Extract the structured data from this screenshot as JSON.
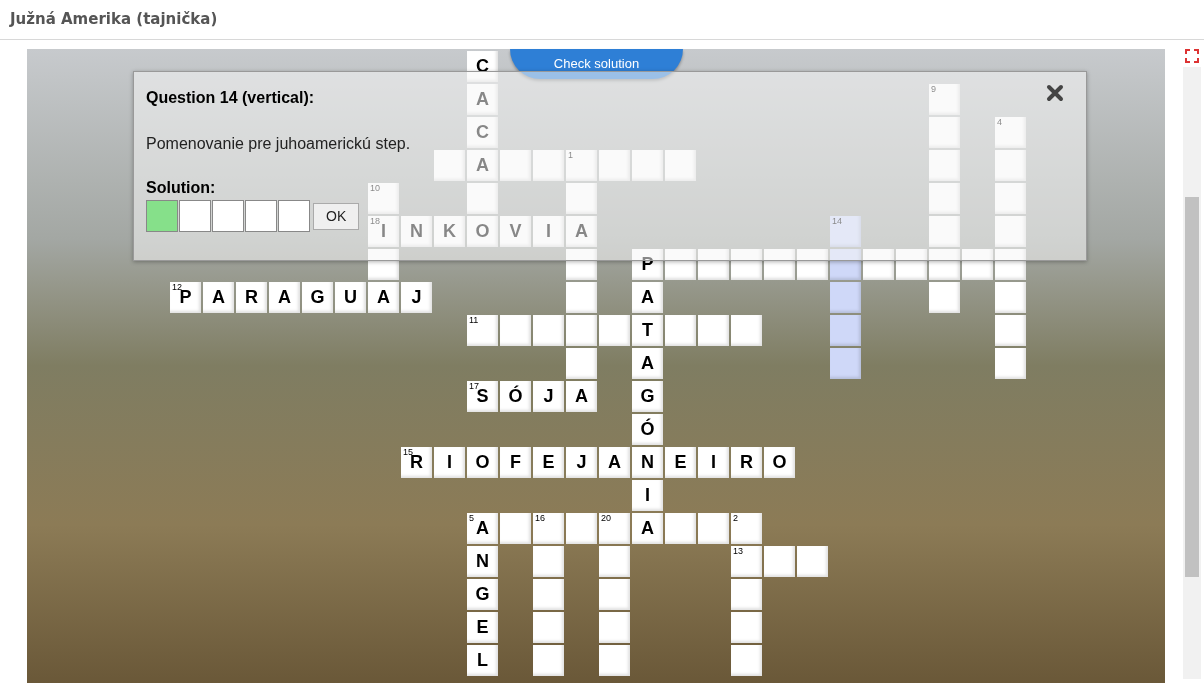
{
  "page_title": "Južná Amerika (tajnička)",
  "check_button": "Check solution",
  "grid": {
    "rows": [
      {
        "cells": [
          null,
          null,
          null,
          null,
          null,
          null,
          null,
          null,
          null,
          {
            "letter": "C",
            "highlighted": false
          },
          null,
          null,
          null,
          null,
          null,
          null,
          null,
          null,
          null,
          null,
          null,
          null,
          null,
          null,
          null,
          null
        ]
      },
      {
        "cells": [
          null,
          null,
          null,
          null,
          null,
          null,
          null,
          null,
          null,
          {
            "letter": "A",
            "highlighted": false
          },
          null,
          null,
          null,
          null,
          null,
          null,
          null,
          null,
          null,
          null,
          null,
          null,
          null,
          {
            "number": "9",
            "highlighted": false
          },
          null,
          null
        ]
      },
      {
        "cells": [
          null,
          null,
          null,
          null,
          null,
          null,
          null,
          null,
          null,
          {
            "letter": "C",
            "highlighted": false
          },
          null,
          null,
          null,
          null,
          null,
          null,
          null,
          null,
          null,
          null,
          null,
          null,
          null,
          {
            "highlighted": false
          },
          null,
          {
            "number": "4",
            "highlighted": false
          }
        ]
      },
      {
        "cells": [
          null,
          null,
          null,
          null,
          null,
          null,
          null,
          null,
          {
            "highlighted": false
          },
          {
            "letter": "A",
            "highlighted": false
          },
          {
            "highlighted": false
          },
          {
            "highlighted": false
          },
          {
            "number": "1",
            "highlighted": false
          },
          {
            "highlighted": false
          },
          {
            "highlighted": false
          },
          {
            "highlighted": false
          },
          null,
          null,
          null,
          null,
          null,
          null,
          null,
          {
            "highlighted": false
          },
          null,
          {
            "highlighted": false
          }
        ]
      },
      {
        "cells": [
          null,
          null,
          null,
          null,
          null,
          null,
          {
            "number": "10",
            "highlighted": false
          },
          null,
          null,
          {
            "highlighted": false
          },
          null,
          null,
          {
            "highlighted": false
          },
          null,
          null,
          null,
          null,
          null,
          null,
          null,
          null,
          null,
          null,
          {
            "highlighted": false
          },
          null,
          {
            "highlighted": false
          }
        ]
      },
      {
        "cells": [
          null,
          null,
          null,
          null,
          null,
          null,
          {
            "letter": "I",
            "number": "18",
            "highlighted": false
          },
          {
            "letter": "N",
            "highlighted": false
          },
          {
            "letter": "K",
            "highlighted": false
          },
          {
            "letter": "O",
            "highlighted": false
          },
          {
            "letter": "V",
            "highlighted": false
          },
          {
            "letter": "I",
            "highlighted": false
          },
          {
            "letter": "A",
            "highlighted": false
          },
          null,
          null,
          null,
          null,
          null,
          null,
          null,
          {
            "number": "14",
            "highlighted": true
          },
          null,
          null,
          {
            "highlighted": false
          },
          null,
          {
            "highlighted": false
          }
        ]
      },
      {
        "cells": [
          null,
          null,
          null,
          null,
          null,
          null,
          {
            "highlighted": false
          },
          null,
          null,
          null,
          null,
          null,
          {
            "highlighted": false
          },
          null,
          {
            "letter": "P",
            "highlighted": false
          },
          {
            "highlighted": false
          },
          {
            "highlighted": false
          },
          {
            "highlighted": false
          },
          {
            "highlighted": false
          },
          {
            "highlighted": false
          },
          {
            "highlighted": true
          },
          {
            "highlighted": false
          },
          {
            "highlighted": false
          },
          {
            "highlighted": false
          },
          {
            "highlighted": false
          },
          {
            "highlighted": false
          }
        ]
      },
      {
        "cells": [
          {
            "letter": "P",
            "number": "12",
            "highlighted": false
          },
          {
            "letter": "A",
            "highlighted": false
          },
          {
            "letter": "R",
            "highlighted": false
          },
          {
            "letter": "A",
            "highlighted": false
          },
          {
            "letter": "G",
            "highlighted": false
          },
          {
            "letter": "U",
            "highlighted": false
          },
          {
            "letter": "A",
            "highlighted": false
          },
          {
            "letter": "J",
            "highlighted": false
          },
          null,
          null,
          null,
          null,
          {
            "highlighted": false
          },
          null,
          {
            "letter": "A",
            "highlighted": false
          },
          null,
          null,
          null,
          null,
          null,
          {
            "highlighted": true
          },
          null,
          null,
          {
            "highlighted": false
          },
          null,
          {
            "highlighted": false
          }
        ]
      },
      {
        "cells": [
          null,
          null,
          null,
          null,
          null,
          null,
          null,
          null,
          null,
          {
            "number": "11",
            "highlighted": false
          },
          {
            "highlighted": false
          },
          {
            "highlighted": false
          },
          {
            "highlighted": false
          },
          {
            "highlighted": false
          },
          {
            "letter": "T",
            "highlighted": false
          },
          {
            "highlighted": false
          },
          {
            "highlighted": false
          },
          {
            "highlighted": false
          },
          null,
          null,
          {
            "highlighted": true
          },
          null,
          null,
          null,
          null,
          {
            "highlighted": false
          }
        ]
      },
      {
        "cells": [
          null,
          null,
          null,
          null,
          null,
          null,
          null,
          null,
          null,
          null,
          null,
          null,
          {
            "highlighted": false
          },
          null,
          {
            "letter": "A",
            "highlighted": false
          },
          null,
          null,
          null,
          null,
          null,
          {
            "highlighted": true
          },
          null,
          null,
          null,
          null,
          {
            "highlighted": false
          }
        ]
      },
      {
        "cells": [
          null,
          null,
          null,
          null,
          null,
          null,
          null,
          null,
          null,
          {
            "letter": "S",
            "number": "17",
            "highlighted": false
          },
          {
            "letter": "Ó",
            "highlighted": false
          },
          {
            "letter": "J",
            "highlighted": false
          },
          {
            "letter": "A",
            "highlighted": false
          },
          null,
          {
            "letter": "G",
            "highlighted": false
          },
          null,
          null,
          null,
          null,
          null,
          null,
          null,
          null,
          null,
          null,
          null
        ]
      },
      {
        "cells": [
          null,
          null,
          null,
          null,
          null,
          null,
          null,
          null,
          null,
          null,
          null,
          null,
          null,
          null,
          {
            "letter": "Ó",
            "highlighted": false
          },
          null,
          null,
          null,
          null,
          null,
          null,
          null,
          null,
          null,
          null,
          null
        ]
      },
      {
        "cells": [
          null,
          null,
          null,
          null,
          null,
          null,
          null,
          {
            "letter": "R",
            "number": "15",
            "highlighted": false
          },
          {
            "letter": "I",
            "highlighted": false
          },
          {
            "letter": "O",
            "highlighted": false
          },
          {
            "letter": "F",
            "highlighted": false
          },
          {
            "letter": "E",
            "highlighted": false
          },
          {
            "letter": "J",
            "highlighted": false
          },
          {
            "letter": "A",
            "highlighted": false
          },
          {
            "letter": "N",
            "highlighted": false
          },
          {
            "letter": "E",
            "highlighted": false
          },
          {
            "letter": "I",
            "highlighted": false
          },
          {
            "letter": "R",
            "highlighted": false
          },
          {
            "letter": "O",
            "highlighted": false
          },
          null,
          null,
          null,
          null,
          null,
          null,
          null
        ]
      },
      {
        "cells": [
          null,
          null,
          null,
          null,
          null,
          null,
          null,
          null,
          null,
          null,
          null,
          null,
          null,
          null,
          {
            "letter": "I",
            "highlighted": false
          },
          null,
          null,
          null,
          null,
          null,
          null,
          null,
          null,
          null,
          null,
          null
        ]
      },
      {
        "cells": [
          null,
          null,
          null,
          null,
          null,
          null,
          null,
          null,
          null,
          {
            "letter": "A",
            "number": "5",
            "highlighted": false
          },
          {
            "highlighted": false
          },
          {
            "number": "16",
            "highlighted": false
          },
          {
            "highlighted": false
          },
          {
            "number": "20",
            "highlighted": false
          },
          {
            "letter": "A",
            "highlighted": false
          },
          {
            "highlighted": false
          },
          {
            "highlighted": false
          },
          {
            "number": "2",
            "highlighted": false
          },
          null,
          null,
          null,
          null,
          null,
          null,
          null,
          null
        ]
      },
      {
        "cells": [
          null,
          null,
          null,
          null,
          null,
          null,
          null,
          null,
          null,
          {
            "letter": "N",
            "highlighted": false
          },
          null,
          {
            "highlighted": false
          },
          null,
          {
            "highlighted": false
          },
          null,
          null,
          null,
          {
            "number": "13",
            "highlighted": false
          },
          {
            "highlighted": false
          },
          {
            "highlighted": false
          },
          null,
          null,
          null,
          null,
          null,
          null
        ]
      },
      {
        "cells": [
          null,
          null,
          null,
          null,
          null,
          null,
          null,
          null,
          null,
          {
            "letter": "G",
            "highlighted": false
          },
          null,
          {
            "highlighted": false
          },
          null,
          {
            "highlighted": false
          },
          null,
          null,
          null,
          {
            "highlighted": false
          },
          null,
          null,
          null,
          null,
          null,
          null,
          null,
          null
        ]
      },
      {
        "cells": [
          null,
          null,
          null,
          null,
          null,
          null,
          null,
          null,
          null,
          {
            "letter": "E",
            "highlighted": false
          },
          null,
          {
            "highlighted": false
          },
          null,
          {
            "highlighted": false
          },
          null,
          null,
          null,
          {
            "highlighted": false
          },
          null,
          null,
          null,
          null,
          null,
          null,
          null,
          null
        ]
      },
      {
        "cells": [
          null,
          null,
          null,
          null,
          null,
          null,
          null,
          null,
          null,
          {
            "letter": "L",
            "highlighted": false
          },
          null,
          {
            "highlighted": false
          },
          null,
          {
            "highlighted": false
          },
          null,
          null,
          null,
          {
            "highlighted": false
          },
          null,
          null,
          null,
          null,
          null,
          null,
          null,
          null
        ]
      }
    ]
  },
  "question": {
    "title": "Question 14 (vertical):",
    "text": "Pomenovanie pre juhoamerickú step.",
    "solution_label": "Solution:",
    "solution_boxes": [
      {
        "active": true
      },
      {
        "active": false
      },
      {
        "active": false
      },
      {
        "active": false
      },
      {
        "active": false
      }
    ],
    "ok_button": "OK"
  }
}
